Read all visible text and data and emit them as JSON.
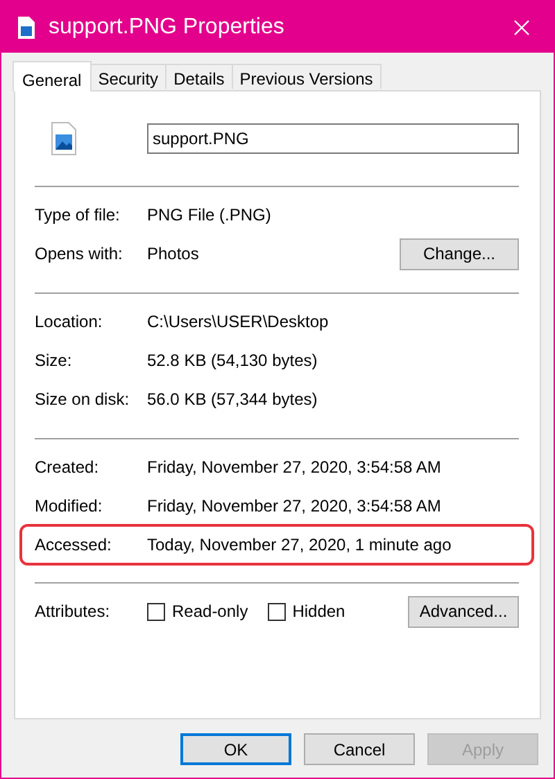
{
  "window": {
    "title": "support.PNG Properties"
  },
  "tabs": [
    {
      "label": "General",
      "selected": true
    },
    {
      "label": "Security",
      "selected": false
    },
    {
      "label": "Details",
      "selected": false
    },
    {
      "label": "Previous Versions",
      "selected": false
    }
  ],
  "file_name": {
    "value": "support.PNG"
  },
  "sections": [
    [
      {
        "label": "Type of file:",
        "value": "PNG File (.PNG)",
        "highlighted": false
      },
      {
        "label": "Opens with:",
        "value": "Photos",
        "button": "Change...",
        "highlighted": false
      }
    ],
    [
      {
        "label": "Location:",
        "value": "C:\\Users\\USER\\Desktop",
        "highlighted": false
      },
      {
        "label": "Size:",
        "value": "52.8 KB (54,130 bytes)",
        "highlighted": false
      },
      {
        "label": "Size on disk:",
        "value": "56.0 KB (57,344 bytes)",
        "highlighted": false
      }
    ],
    [
      {
        "label": "Created:",
        "value": "Friday, November 27, 2020, 3:54:58 AM",
        "highlighted": false
      },
      {
        "label": "Modified:",
        "value": "Friday, November 27, 2020, 3:54:58 AM",
        "highlighted": false
      },
      {
        "label": "Accessed:",
        "value": "Today, November 27, 2020, 1 minute ago",
        "highlighted": true
      }
    ]
  ],
  "attributes": {
    "label": "Attributes:",
    "checkboxes": [
      {
        "label": "Read-only",
        "checked": false
      },
      {
        "label": "Hidden",
        "checked": false
      }
    ],
    "button": "Advanced..."
  },
  "buttons": [
    {
      "label": "OK",
      "kind": "default"
    },
    {
      "label": "Cancel",
      "kind": "normal"
    },
    {
      "label": "Apply",
      "kind": "disabled"
    }
  ]
}
